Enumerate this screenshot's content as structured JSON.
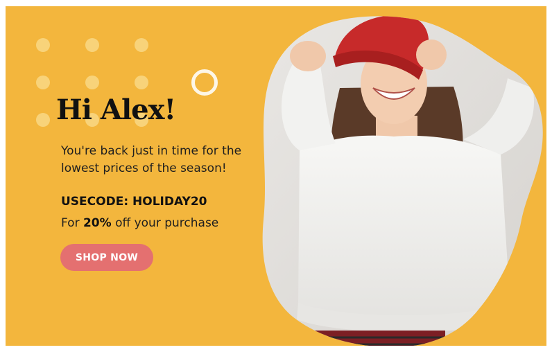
{
  "banner": {
    "greeting": "Hi Alex!",
    "tagline_line1": "You're back just in time for the",
    "tagline_line2": "lowest prices of the season!",
    "promo_code": "USECODE: HOLIDAY20",
    "offer_prefix": "For ",
    "offer_percent": "20%",
    "offer_suffix": " off your purchase",
    "cta_label": "SHOP NOW",
    "hero_image": "woman-in-red-beanie-photo"
  },
  "colors": {
    "background": "#f3b63d",
    "dots": "#f8d37a",
    "ring": "#fdf6e6",
    "cta": "#e47070",
    "cta_text": "#ffffff",
    "heading_text": "#111111",
    "body_text": "#1f1f1f"
  }
}
